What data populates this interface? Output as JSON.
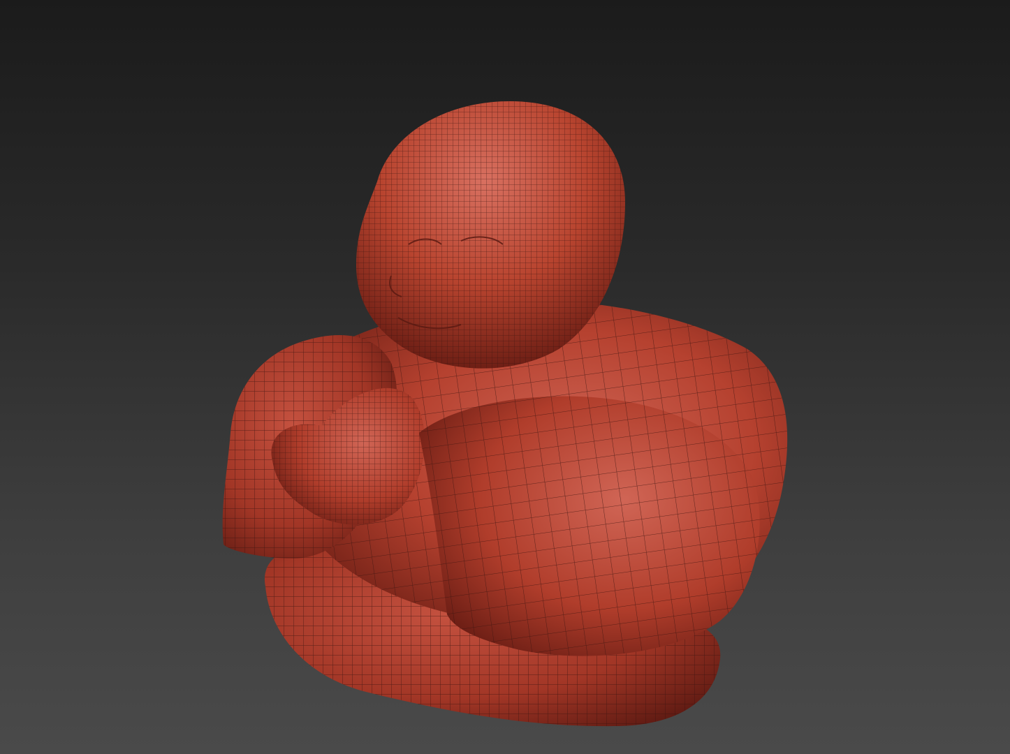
{
  "viewport": {
    "background_top": "#1b1b1b",
    "background_bottom": "#4a4a4a"
  },
  "model": {
    "subject": "seated-laughing-buddha-figure",
    "display_mode": "wireframe-on-shaded",
    "surface_color": "#b5412f",
    "surface_highlight": "#d46a58",
    "surface_shadow": "#6e1f15",
    "wire_color": "#3a1410"
  }
}
